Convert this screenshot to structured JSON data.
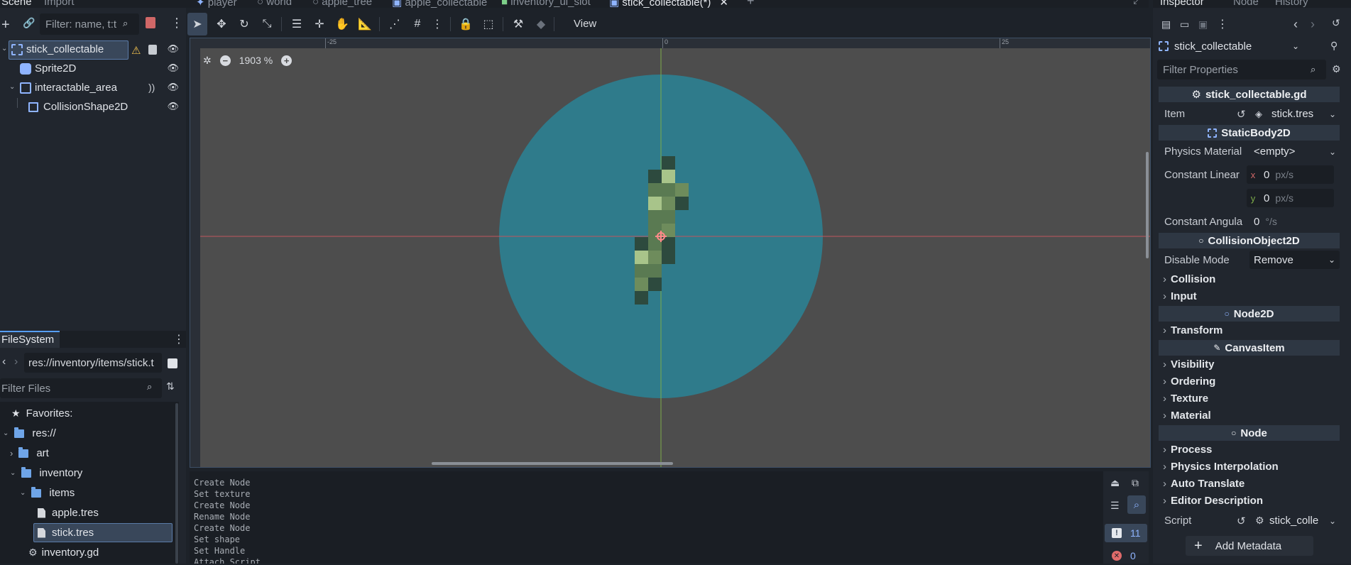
{
  "scene_dock": {
    "tabs": [
      "Scene",
      "Import"
    ],
    "filter_placeholder": "Filter: name, t:t",
    "nodes": [
      {
        "label": "stick_collectable"
      },
      {
        "label": "Sprite2D"
      },
      {
        "label": "interactable_area"
      },
      {
        "label": "CollisionShape2D"
      }
    ]
  },
  "filesystem": {
    "tab": "FileSystem",
    "path": "res://inventory/items/stick.t",
    "filter_placeholder": "Filter Files",
    "items": [
      {
        "label": "Favorites:"
      },
      {
        "label": "res://"
      },
      {
        "label": "art"
      },
      {
        "label": "inventory"
      },
      {
        "label": "items"
      },
      {
        "label": "apple.tres"
      },
      {
        "label": "stick.tres"
      },
      {
        "label": "inventory.gd"
      }
    ]
  },
  "editor_tabs": [
    "player",
    "world",
    "apple_tree",
    "apple_collectable",
    "inventory_ui_slot",
    "stick_collectable(*)"
  ],
  "toolbar": {
    "view_label": "View"
  },
  "viewport": {
    "zoom": "1903 %",
    "ruler_labels": [
      "-25",
      "0",
      "25"
    ],
    "colors": {
      "shape": "#2a8497",
      "bg": "#4d4d4d",
      "axis_x": "#c0565e",
      "axis_y": "#7dab4a"
    }
  },
  "output": {
    "lines": [
      "Create Node",
      "Set texture",
      "Create Node",
      "Rename Node",
      "Create Node",
      "Set shape",
      "Set Handle",
      "Attach Script"
    ],
    "warning_count": "11",
    "error_count": "0"
  },
  "inspector": {
    "tabs": [
      "Inspector",
      "Node",
      "History"
    ],
    "object": "stick_collectable",
    "filter_placeholder": "Filter Properties",
    "script_header": "stick_collectable.gd",
    "item_label": "Item",
    "item_value": "stick.tres",
    "static_body": "StaticBody2D",
    "physics_material_label": "Physics Material",
    "physics_material_value": "<empty>",
    "constant_linear_label": "Constant Linear",
    "x_label": "x",
    "y_label": "y",
    "cl_x": "0",
    "cl_y": "0",
    "px_unit": "px/s",
    "constant_angular_label": "Constant Angula",
    "ca_value": "0",
    "ca_unit": "°/s",
    "collision_object": "CollisionObject2D",
    "disable_mode_label": "Disable Mode",
    "disable_mode_value": "Remove",
    "groups_a": [
      "Collision",
      "Input"
    ],
    "node2d": "Node2D",
    "groups_b": [
      "Transform"
    ],
    "canvas_item": "CanvasItem",
    "groups_c": [
      "Visibility",
      "Ordering",
      "Texture",
      "Material"
    ],
    "node": "Node",
    "groups_d": [
      "Process",
      "Physics Interpolation",
      "Auto Translate",
      "Editor Description"
    ],
    "script_label": "Script",
    "script_value": "stick_colle",
    "add_metadata": "Add Metadata"
  }
}
